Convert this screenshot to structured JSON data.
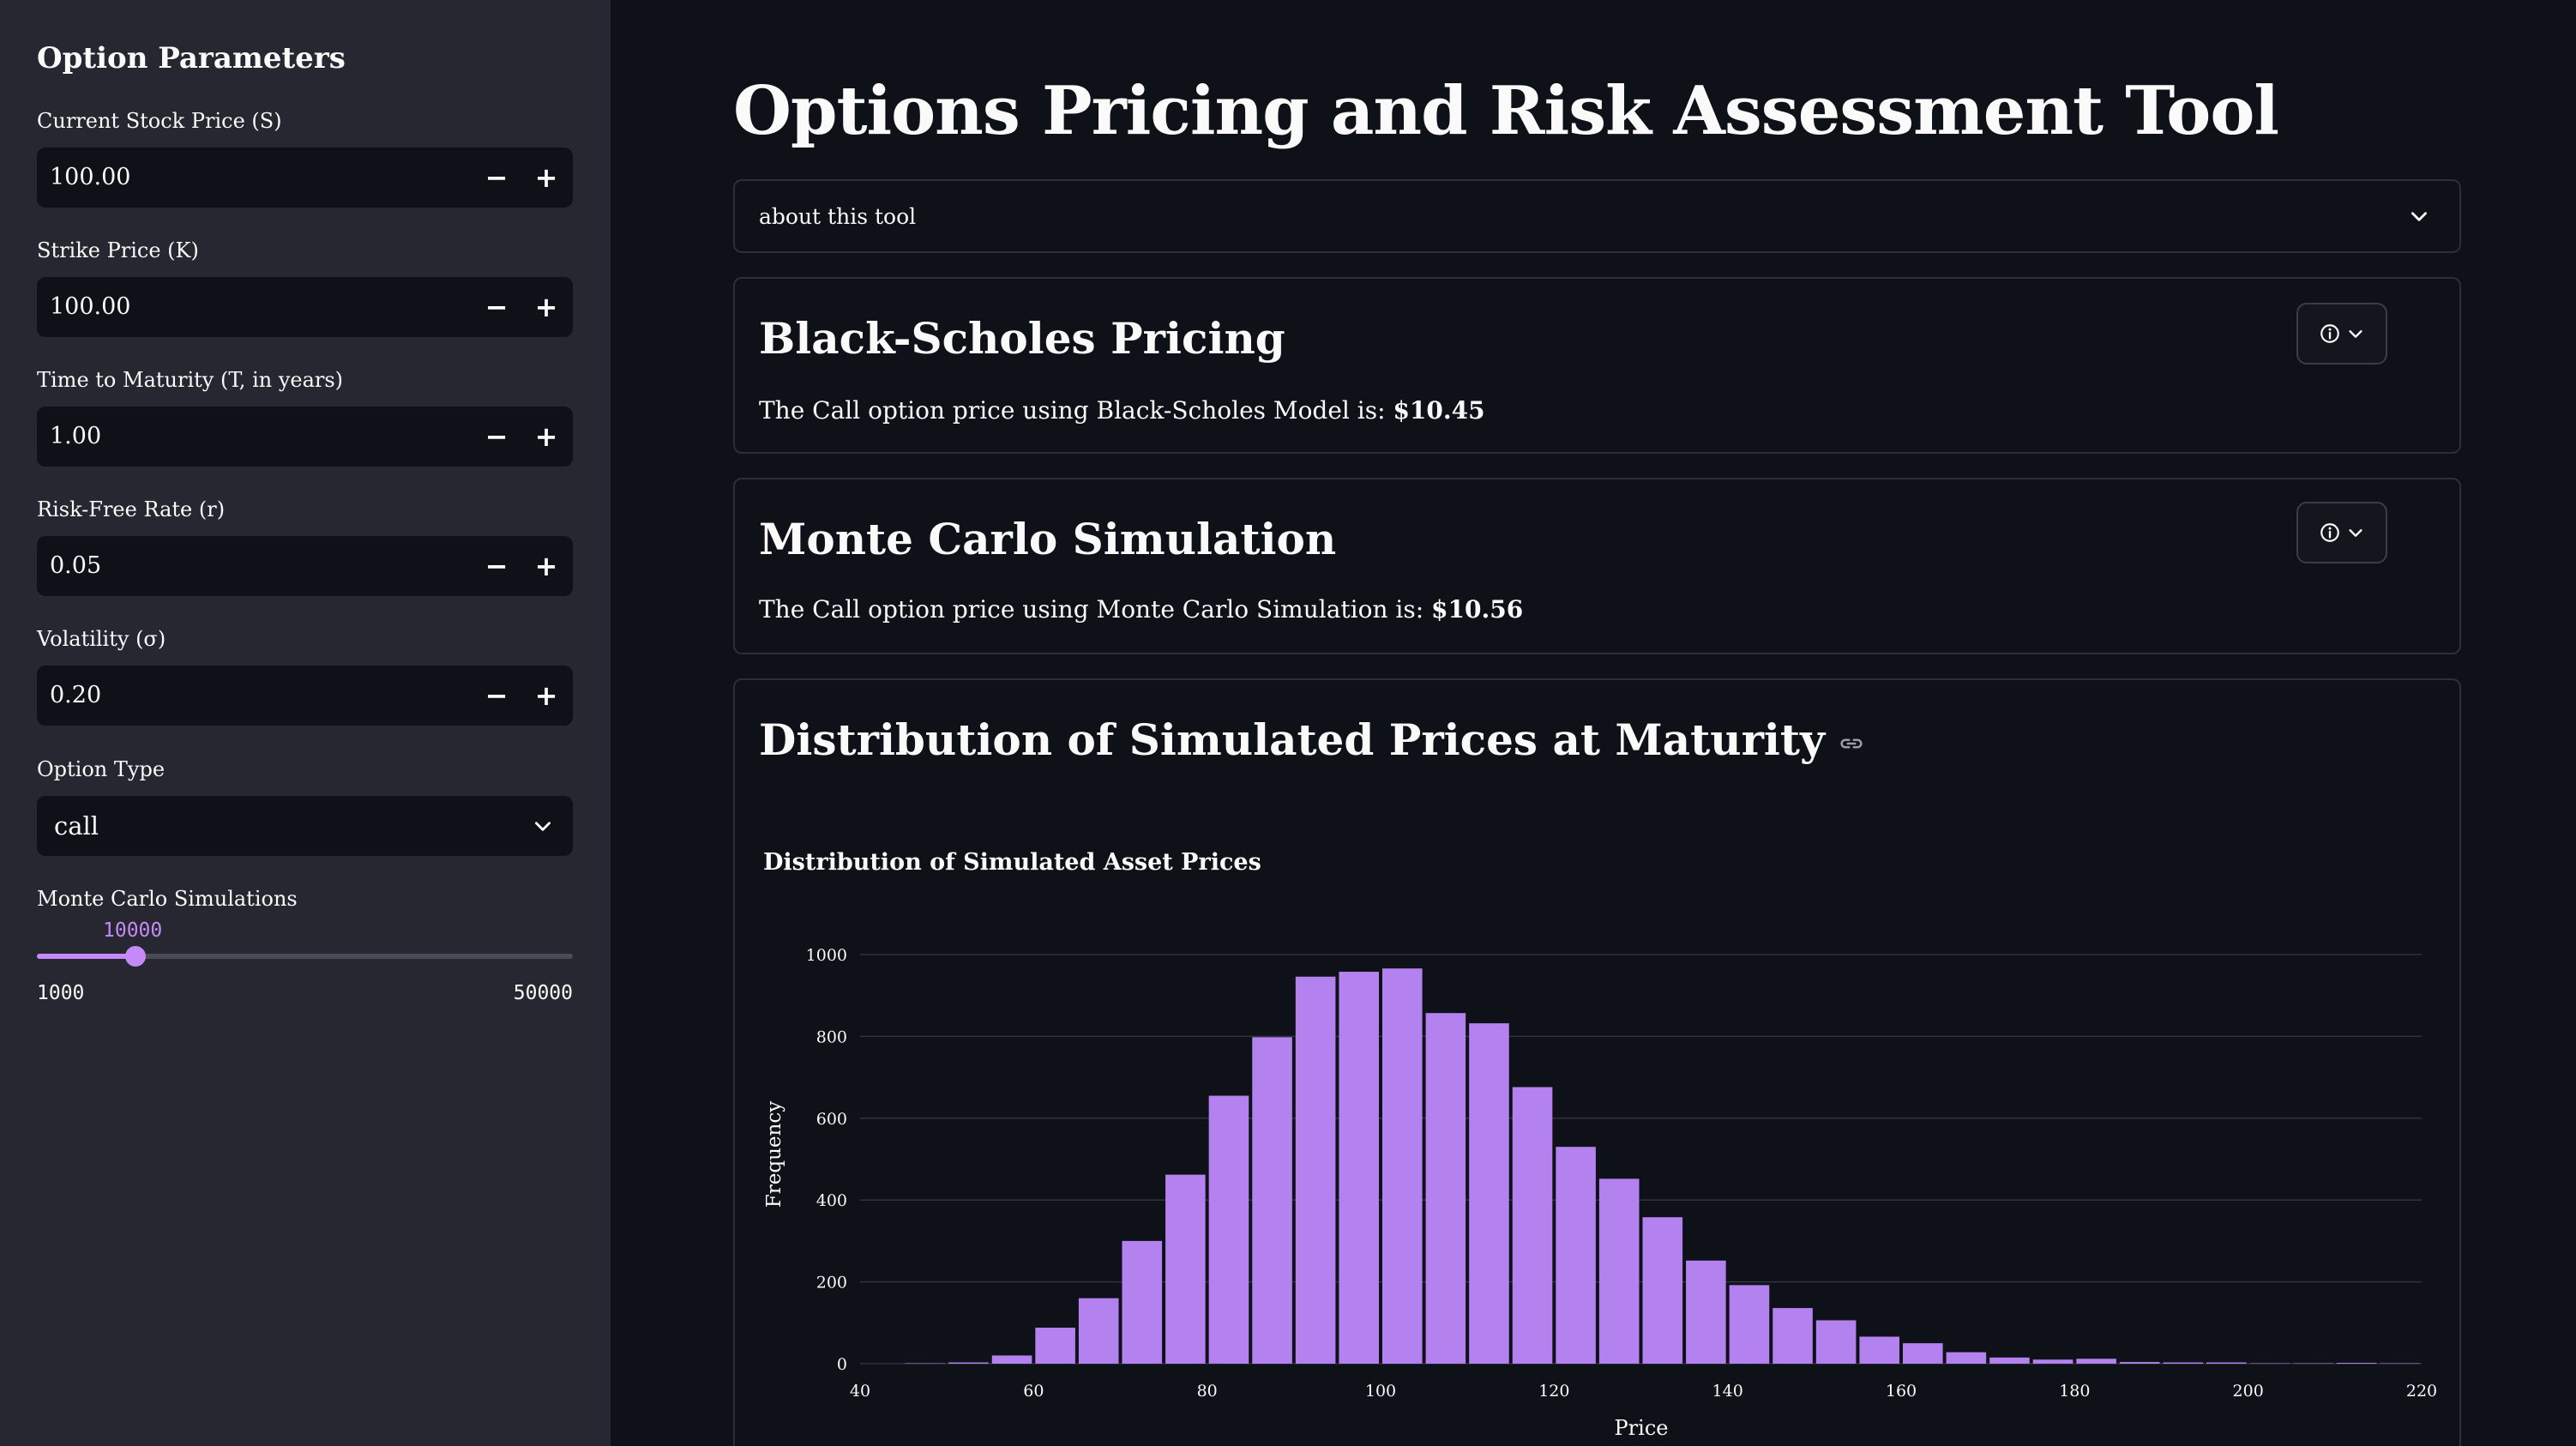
{
  "sidebar": {
    "title": "Option Parameters",
    "fields": [
      {
        "label": "Current Stock Price (S)",
        "value": "100.00"
      },
      {
        "label": "Strike Price (K)",
        "value": "100.00"
      },
      {
        "label": "Time to Maturity (T, in years)",
        "value": "1.00"
      },
      {
        "label": "Risk-Free Rate (r)",
        "value": "0.05"
      },
      {
        "label": "Volatility (σ)",
        "value": "0.20"
      }
    ],
    "minus_glyph": "−",
    "plus_glyph": "+",
    "option_type": {
      "label": "Option Type",
      "value": "call"
    },
    "simulations": {
      "label": "Monte Carlo Simulations",
      "value": "10000",
      "min": "1000",
      "max": "50000",
      "level": 10000,
      "range": [
        1000,
        50000
      ]
    }
  },
  "main": {
    "title": "Options Pricing and Risk Assessment Tool",
    "expander_label": "about this tool",
    "black_scholes": {
      "heading": "Black-Scholes Pricing",
      "text": "The Call option price using Black-Scholes Model is: ",
      "price": "$10.45"
    },
    "monte_carlo": {
      "heading": "Monte Carlo Simulation",
      "text": "The Call option price using Monte Carlo Simulation is: ",
      "price": "$10.56"
    },
    "distribution": {
      "heading": "Distribution of Simulated Prices at Maturity"
    }
  },
  "colors": {
    "accent": "#c58af9",
    "bar": "#b482ef",
    "background": "#0e1117",
    "sidebar": "#262730"
  },
  "icons": [
    "chevron-down-icon",
    "info-icon",
    "link-icon"
  ],
  "chart_data": {
    "type": "bar",
    "title": "Distribution of Simulated Asset Prices",
    "xlabel": "Price",
    "ylabel": "Frequency",
    "xlim": [
      40,
      220
    ],
    "ylim": [
      0,
      1000
    ],
    "xticks": [
      40,
      60,
      80,
      100,
      120,
      140,
      160,
      180,
      200,
      220
    ],
    "yticks": [
      0,
      200,
      400,
      600,
      800,
      1000
    ],
    "grid": true,
    "bin_width": 5,
    "bins": [
      {
        "x": 47.5,
        "y": 1
      },
      {
        "x": 52.5,
        "y": 3
      },
      {
        "x": 57.5,
        "y": 20
      },
      {
        "x": 62.5,
        "y": 88
      },
      {
        "x": 67.5,
        "y": 160
      },
      {
        "x": 72.5,
        "y": 300
      },
      {
        "x": 77.5,
        "y": 462
      },
      {
        "x": 82.5,
        "y": 655
      },
      {
        "x": 87.5,
        "y": 798
      },
      {
        "x": 92.5,
        "y": 946
      },
      {
        "x": 97.5,
        "y": 958
      },
      {
        "x": 102.5,
        "y": 966
      },
      {
        "x": 107.5,
        "y": 857
      },
      {
        "x": 112.5,
        "y": 832
      },
      {
        "x": 117.5,
        "y": 676
      },
      {
        "x": 122.5,
        "y": 530
      },
      {
        "x": 127.5,
        "y": 452
      },
      {
        "x": 132.5,
        "y": 358
      },
      {
        "x": 137.5,
        "y": 252
      },
      {
        "x": 142.5,
        "y": 192
      },
      {
        "x": 147.5,
        "y": 136
      },
      {
        "x": 152.5,
        "y": 106
      },
      {
        "x": 157.5,
        "y": 66
      },
      {
        "x": 162.5,
        "y": 50
      },
      {
        "x": 167.5,
        "y": 28
      },
      {
        "x": 172.5,
        "y": 15
      },
      {
        "x": 177.5,
        "y": 10
      },
      {
        "x": 182.5,
        "y": 12
      },
      {
        "x": 187.5,
        "y": 4
      },
      {
        "x": 192.5,
        "y": 3
      },
      {
        "x": 197.5,
        "y": 3
      },
      {
        "x": 202.5,
        "y": 1
      },
      {
        "x": 207.5,
        "y": 1
      },
      {
        "x": 212.5,
        "y": 2
      },
      {
        "x": 217.5,
        "y": 1
      }
    ]
  }
}
